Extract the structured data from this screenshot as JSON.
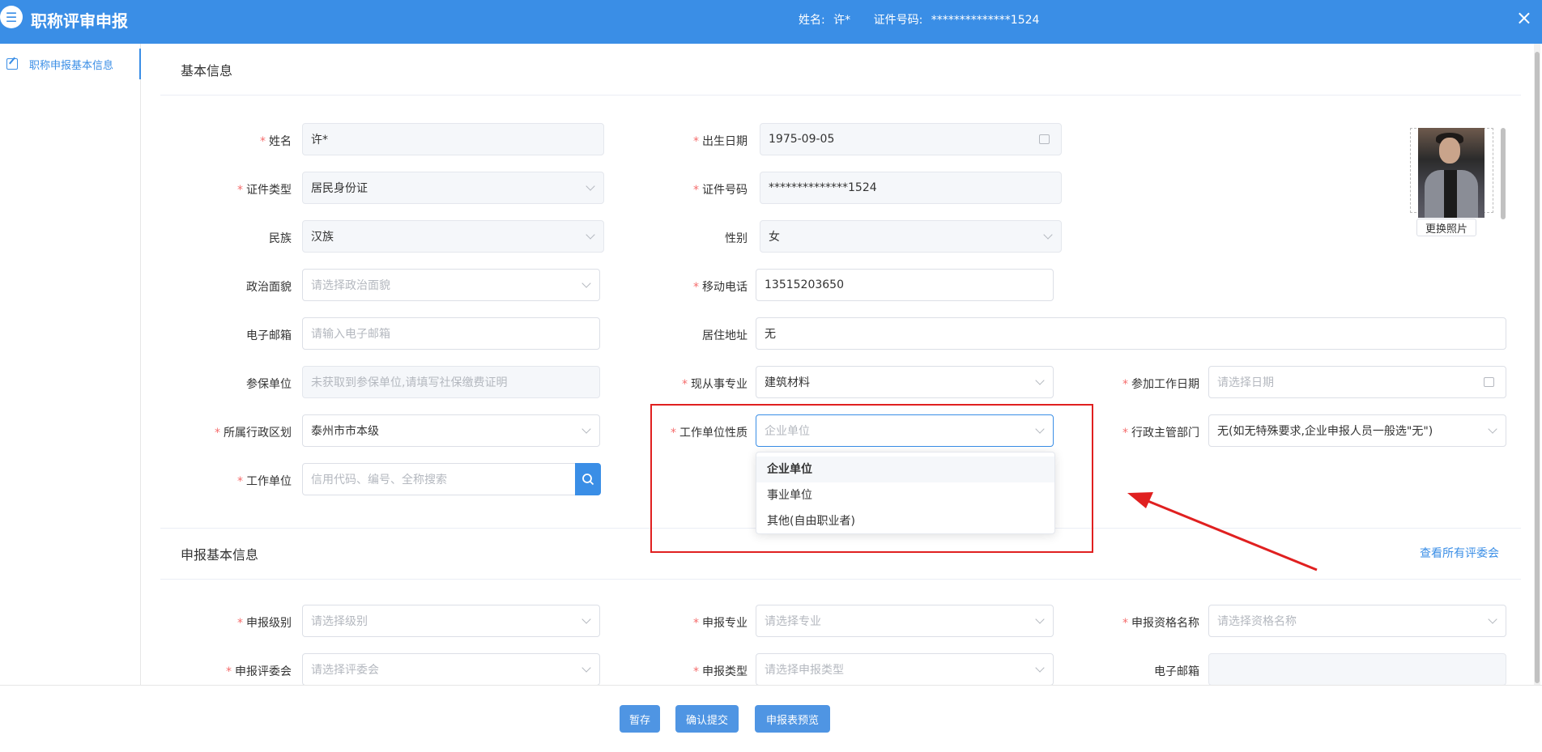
{
  "header": {
    "title": "职称评审申报",
    "name_label": "姓名:",
    "name_value": "许*",
    "id_label": "证件号码:",
    "id_value": "**************1524",
    "close": "×"
  },
  "sidebar": {
    "items": [
      {
        "label": "职称申报基本信息"
      }
    ]
  },
  "basic": {
    "title": "基本信息",
    "name": {
      "label": "姓名",
      "value": "许*"
    },
    "birth": {
      "label": "出生日期",
      "value": "1975-09-05"
    },
    "id_type": {
      "label": "证件类型",
      "value": "居民身份证"
    },
    "id_no": {
      "label": "证件号码",
      "value": "**************1524"
    },
    "ethnic": {
      "label": "民族",
      "value": "汉族"
    },
    "gender": {
      "label": "性别",
      "value": "女"
    },
    "political": {
      "label": "政治面貌",
      "placeholder": "请选择政治面貌"
    },
    "mobile": {
      "label": "移动电话",
      "value": "13515203650"
    },
    "email": {
      "label": "电子邮箱",
      "placeholder": "请输入电子邮箱"
    },
    "address": {
      "label": "居住地址",
      "value": "无"
    },
    "insured_unit": {
      "label": "参保单位",
      "placeholder": "未获取到参保单位,请填写社保缴费证明"
    },
    "major": {
      "label": "现从事专业",
      "value": "建筑材料"
    },
    "work_date": {
      "label": "参加工作日期",
      "placeholder": "请选择日期"
    },
    "region": {
      "label": "所属行政区划",
      "value": "泰州市市本级"
    },
    "unit_nature": {
      "label": "工作单位性质",
      "placeholder": "企业单位"
    },
    "admin_dept": {
      "label": "行政主管部门",
      "value": "无(如无特殊要求,企业申报人员一般选\"无\")"
    },
    "work_unit": {
      "label": "工作单位",
      "placeholder": "信用代码、编号、全称搜索"
    },
    "change_photo": "更换照片"
  },
  "dropdown": {
    "options": [
      "企业单位",
      "事业单位",
      "其他(自由职业者)"
    ],
    "selected": "企业单位"
  },
  "apply": {
    "title": "申报基本信息",
    "view_all_link": "查看所有评委会",
    "level": {
      "label": "申报级别",
      "placeholder": "请选择级别"
    },
    "specialty": {
      "label": "申报专业",
      "placeholder": "请选择专业"
    },
    "qualification": {
      "label": "申报资格名称",
      "placeholder": "请选择资格名称"
    },
    "committee": {
      "label": "申报评委会",
      "placeholder": "请选择评委会"
    },
    "type": {
      "label": "申报类型",
      "placeholder": "请选择申报类型"
    },
    "email": {
      "label": "电子邮箱",
      "value": ""
    }
  },
  "footer": {
    "save": "暂存",
    "submit": "确认提交",
    "preview": "申报表预览"
  },
  "colors": {
    "primary": "#3a8ee6",
    "required": "#f56c6c",
    "annotation": "#e02020"
  }
}
